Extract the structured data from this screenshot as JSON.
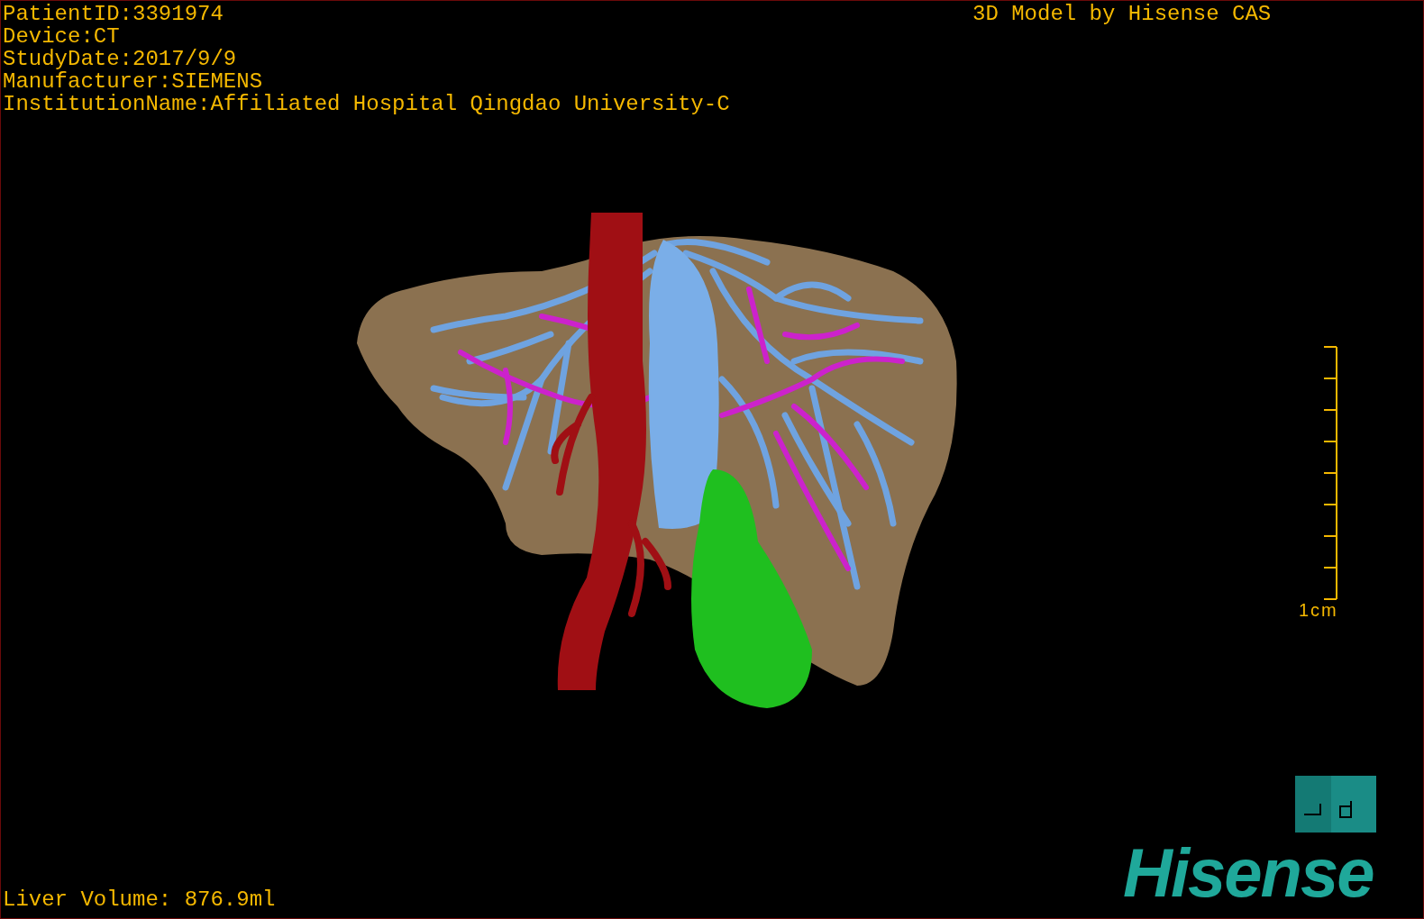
{
  "patient_info": [
    "PatientID:3391974",
    "Device:CT",
    "StudyDate:2017/9/9",
    "Manufacturer:SIEMENS",
    "InstitutionName:Affiliated Hospital Qingdao University-C"
  ],
  "model_credit": "3D Model by Hisense CAS",
  "scale_bar": {
    "label": "1cm"
  },
  "liver_volume": "Liver Volume: 876.9ml",
  "logo": "Hisense"
}
